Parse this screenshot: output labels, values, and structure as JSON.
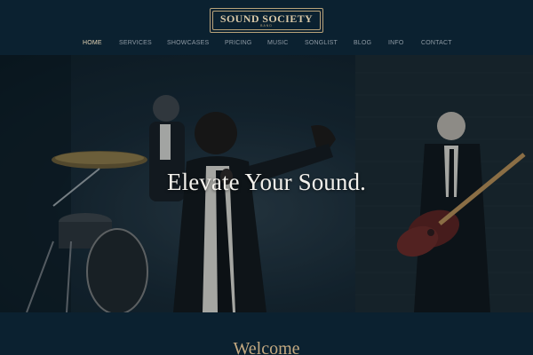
{
  "header": {
    "logo_text": "SOUND SOCIETY",
    "logo_sub": "BAND"
  },
  "nav": {
    "items": [
      {
        "label": "HOME",
        "active": true
      },
      {
        "label": "SERVICES",
        "active": false
      },
      {
        "label": "SHOWCASES",
        "active": false
      },
      {
        "label": "PRICING",
        "active": false
      },
      {
        "label": "MUSIC",
        "active": false
      },
      {
        "label": "SONGLIST",
        "active": false
      },
      {
        "label": "BLOG",
        "active": false
      },
      {
        "label": "INFO",
        "active": false
      },
      {
        "label": "CONTACT",
        "active": false
      }
    ]
  },
  "hero": {
    "title": "Elevate Your Sound."
  },
  "welcome": {
    "title": "Welcome"
  },
  "colors": {
    "background": "#0b2130",
    "accent_gold": "#c3a981",
    "nav_active": "#e2d3b4",
    "nav_inactive": "#8e9aa4"
  }
}
